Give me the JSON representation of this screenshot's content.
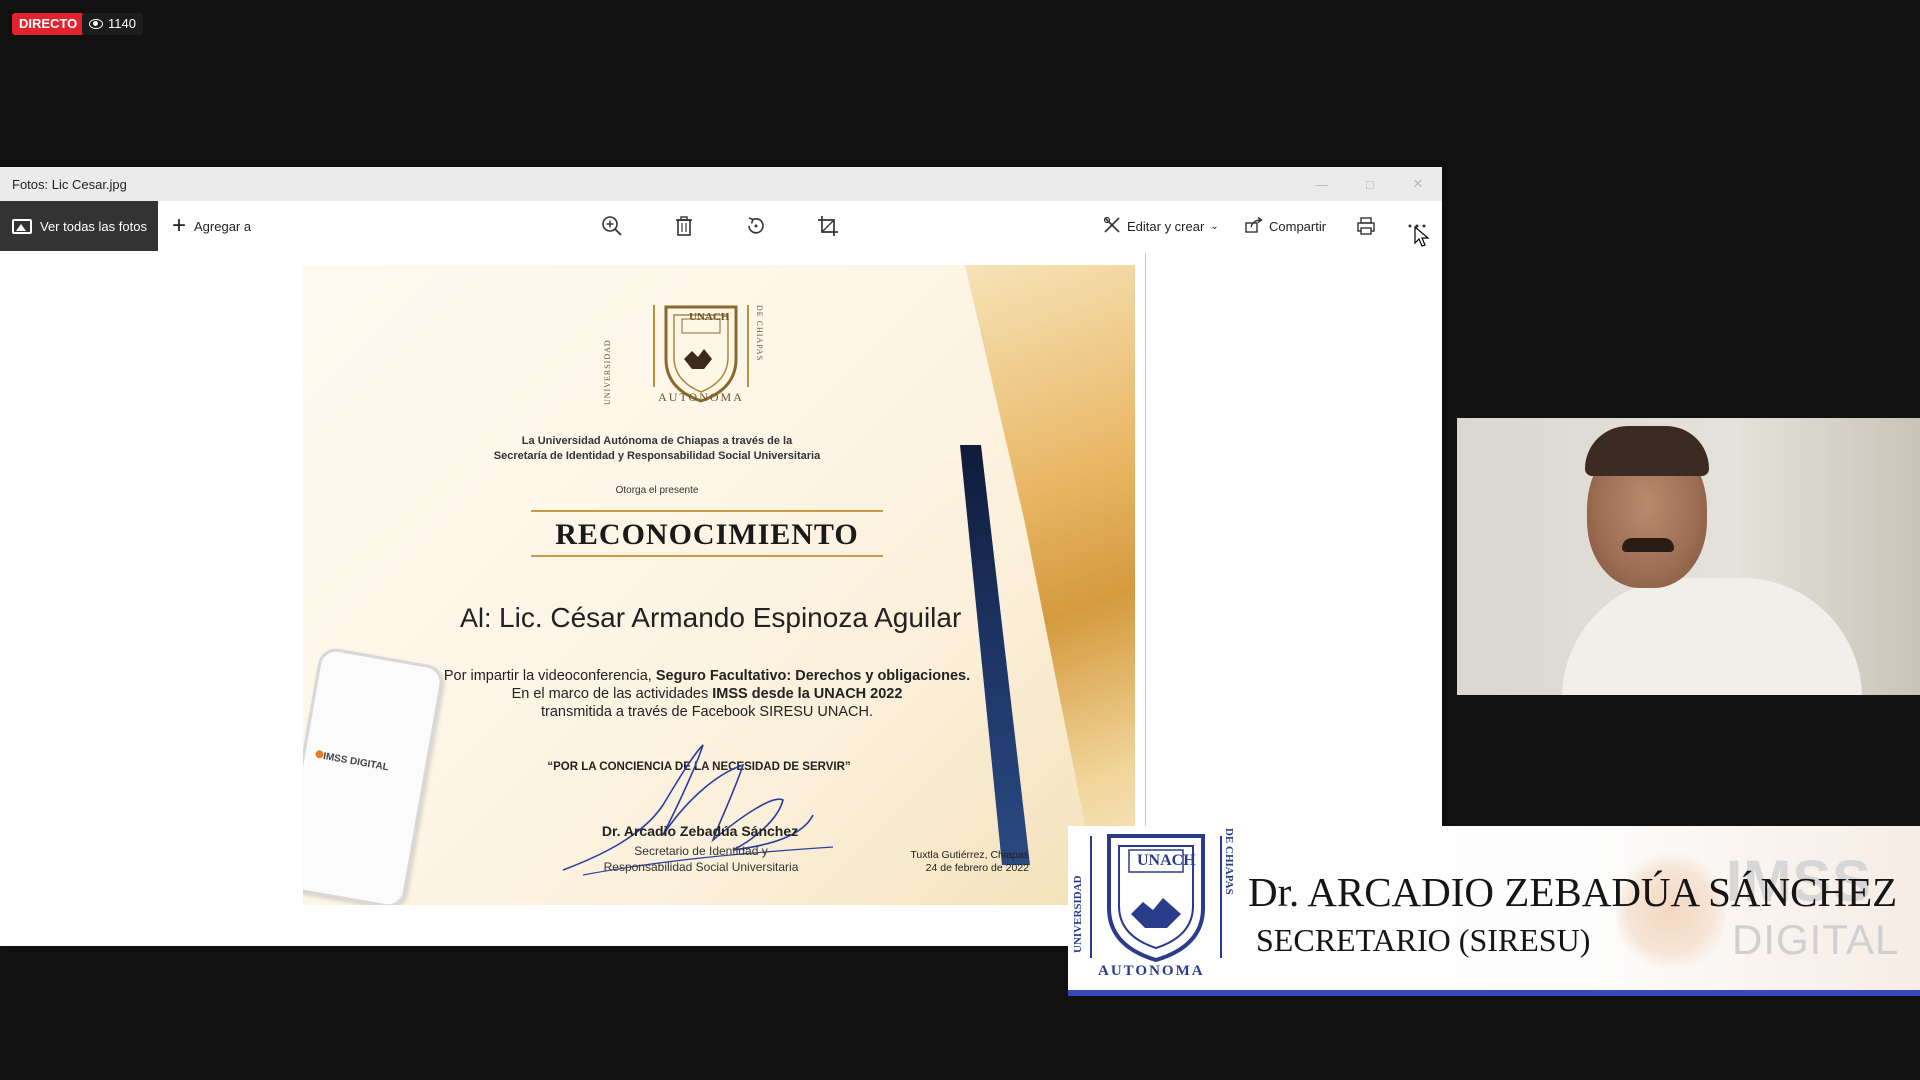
{
  "stream": {
    "live_label": "DIRECTO",
    "viewers": "1140"
  },
  "window": {
    "title": "Fotos: Lic Cesar.jpg",
    "toolbar": {
      "view_all": "Ver todas las fotos",
      "add_to": "Agregar a",
      "edit_create": "Editar y crear",
      "share": "Compartir",
      "icons": [
        "zoom-in-icon",
        "trash-icon",
        "rotate-icon",
        "crop-icon",
        "print-icon",
        "more-icon"
      ]
    }
  },
  "certificate": {
    "autonoma": "AUTONOMA",
    "intro_line1": "La Universidad Autónoma de Chiapas a través de la",
    "intro_line2": "Secretaría de Identidad y Responsabilidad Social Universitaria",
    "grants": "Otorga el presente",
    "title": "RECONOCIMIENTO",
    "recipient_prefix": "Al:",
    "recipient": "Lic. César Armando Espinoza Aguilar",
    "body_line1_pre": "Por impartir la videoconferencia, ",
    "body_line1_bold": "Seguro Facultativo: Derechos y obligaciones.",
    "body_line2_pre": "En el marco de las actividades ",
    "body_line2_bold": "IMSS desde la UNACH 2022",
    "body_line3": "transmitida a través de Facebook SIRESU UNACH.",
    "motto": "“POR LA CONCIENCIA DE LA NECESIDAD DE SERVIR”",
    "signer": "Dr. Arcadio Zebadúa Sánchez",
    "signer_role1": "Secretario de Identidad y",
    "signer_role2": "Responsabilidad Social Universitaria",
    "place": "Tuxtla Gutiérrez, Chiapas",
    "date": "24 de febrero de 2022",
    "phone_brand": "IMSS DIGITAL",
    "logo_text": "UNACH",
    "logo_arc_left": "UNIVERSIDAD",
    "logo_arc_right": "DE CHIAPAS"
  },
  "lower_third": {
    "name": "Dr. ARCADIO ZEBADÚA SÁNCHEZ",
    "title": "SECRETARIO (SIRESU)",
    "logo_text": "UNACH",
    "autonoma": "AUTONOMA",
    "arc_left": "UNIVERSIDAD",
    "arc_right": "DE CHIAPAS",
    "brand_line1": "IMSS",
    "brand_line2": "DIGITAL"
  },
  "colors": {
    "live_red": "#e0242f",
    "accent_blue": "#3a47b8",
    "gold": "#c79c45"
  }
}
